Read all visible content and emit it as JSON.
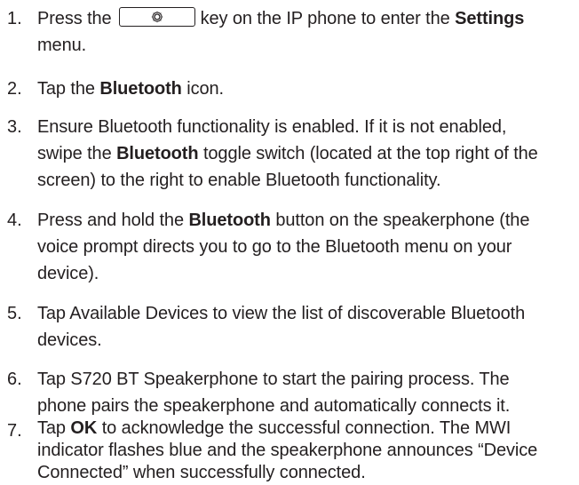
{
  "steps": [
    {
      "num": "1.",
      "a": "Press the",
      "b": "key on the IP phone to enter the",
      "c": "Settings",
      "d": "menu.",
      "icon": "gear-key-icon"
    },
    {
      "num": "2.",
      "a": "Tap the",
      "b": "Bluetooth",
      "c": "icon."
    },
    {
      "num": "3.",
      "l1": "Ensure Bluetooth functionality is enabled. If it is not enabled,",
      "l2a": "swipe the",
      "l2b": "Bluetooth",
      "l2c": "toggle switch (located at the top right of the",
      "l3": "screen) to the right to enable Bluetooth functionality."
    },
    {
      "num": "4.",
      "l1a": "Press and hold the",
      "l1b": "Bluetooth",
      "l1c": "button on the speakerphone (the",
      "l2": "voice prompt directs you to go to the Bluetooth menu on your",
      "l3": "device)."
    },
    {
      "num": "5.",
      "l1": "Tap Available Devices to view the list of discoverable Bluetooth",
      "l2": "devices."
    },
    {
      "num": "6.",
      "l1": "Tap S720 BT Speakerphone to start the pairing process. The",
      "l2": "phone pairs the speakerphone and automatically connects it."
    },
    {
      "num": "7.",
      "l1a": "Tap",
      "l1b": "OK",
      "l1c": "to acknowledge the successful connection. The MWI",
      "l2": "indicator flashes blue and the speakerphone announces “Device",
      "l3": "Connected” when successfully connected."
    }
  ]
}
